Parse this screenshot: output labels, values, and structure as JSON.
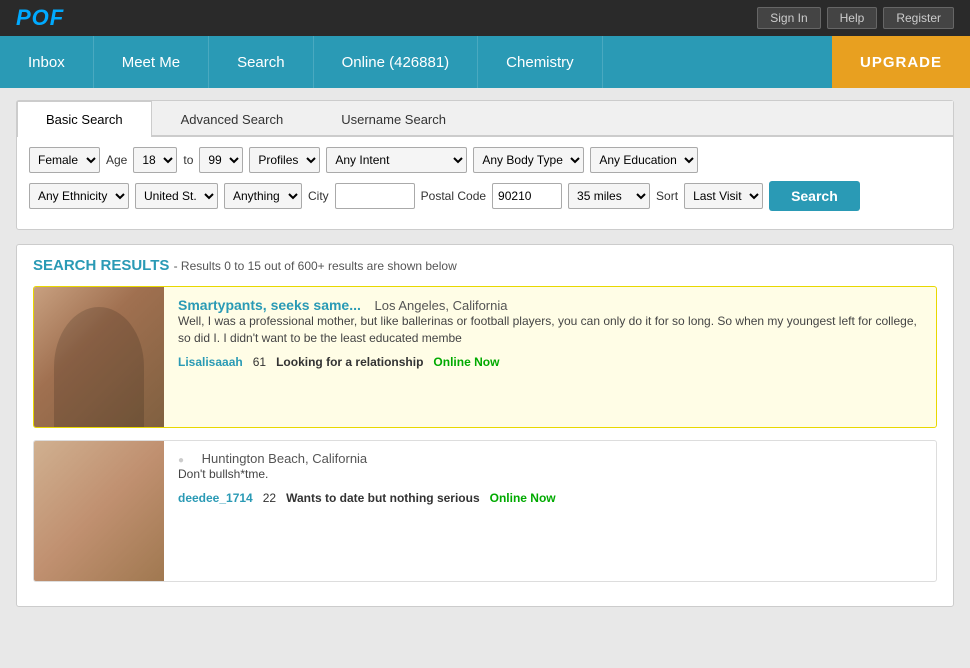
{
  "topbar": {
    "logo": "POF",
    "links": [
      "Sign In",
      "Help",
      "Register"
    ]
  },
  "nav": {
    "items": [
      {
        "label": "Inbox",
        "id": "inbox"
      },
      {
        "label": "Meet Me",
        "id": "meet-me"
      },
      {
        "label": "Search",
        "id": "search"
      },
      {
        "label": "Online (426881)",
        "id": "online"
      },
      {
        "label": "Chemistry",
        "id": "chemistry"
      },
      {
        "label": "UPGRADE",
        "id": "upgrade"
      }
    ]
  },
  "search": {
    "tabs": [
      {
        "label": "Basic Search",
        "active": true
      },
      {
        "label": "Advanced Search",
        "active": false
      },
      {
        "label": "Username Search",
        "active": false
      }
    ],
    "filters": {
      "gender": "Female",
      "age_label": "Age",
      "age_from": "18",
      "age_to": "99",
      "profiles": "Profiles",
      "intent": "Any Intent",
      "body_type": "Any Body Type",
      "education": "Any Education",
      "ethnicity": "Any Ethnicity",
      "country": "United St.",
      "relationship": "Anything",
      "city_label": "City",
      "city_value": "",
      "postal_label": "Postal Code",
      "postal_value": "90210",
      "distance": "35 miles",
      "sort_label": "Sort",
      "sort": "Last Visit",
      "search_btn": "Search"
    }
  },
  "results": {
    "heading": "SEARCH RESULTS",
    "subtext": "- Results 0 to 15 out of 600+ results are shown below",
    "cards": [
      {
        "title": "Smartypants, seeks same...",
        "location": "Los Angeles, California",
        "description": "Well, I was a professional mother, but like ballerinas or football players, you can only do it for so long. So when my youngest left for college, so did I. I didn't want to be the least educated membe",
        "username": "Lisalisaaah",
        "age": "61",
        "intent": "Looking for a relationship",
        "online": "Online Now",
        "highlighted": true,
        "photo_class": "photo-1"
      },
      {
        "title": "",
        "location": "Huntington Beach, California",
        "description": "Don't bullsh*tme.",
        "username": "deedee_1714",
        "age": "22",
        "intent": "Wants to date but nothing serious",
        "online": "Online Now",
        "highlighted": false,
        "photo_class": "photo-2"
      }
    ]
  }
}
